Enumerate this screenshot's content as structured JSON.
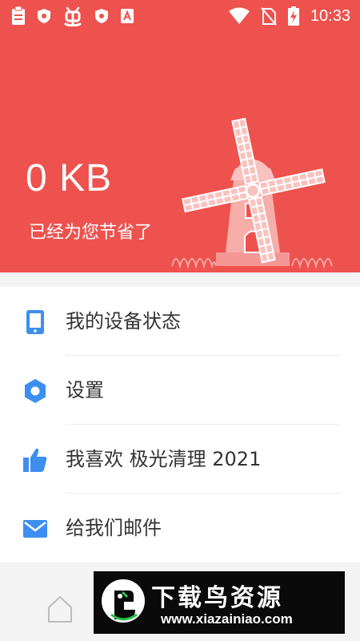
{
  "status_bar": {
    "time": "10:33",
    "left_icons": [
      "clipboard-icon",
      "shield-icon",
      "bug-icon",
      "shield-icon",
      "app-a-icon"
    ],
    "right_icons": [
      "wifi-icon",
      "no-sim-icon",
      "battery-charging-icon"
    ]
  },
  "header": {
    "background_color": "#ee524e",
    "saved_value": "0 KB",
    "saved_caption": "已经为您节省了",
    "illustration": "windmill-illustration"
  },
  "menu": {
    "items": [
      {
        "icon": "phone-icon",
        "label": "我的设备状态",
        "color": "#3d8ef0"
      },
      {
        "icon": "settings-icon",
        "label": "设置",
        "color": "#3d8ef0"
      },
      {
        "icon": "thumbs-up-icon",
        "label": "我喜欢 极光清理 2021",
        "color": "#3d8ef0"
      },
      {
        "icon": "mail-icon",
        "label": "给我们邮件",
        "color": "#3d8ef0"
      }
    ]
  },
  "navbar": {
    "home_icon": "home-icon"
  },
  "watermark": {
    "title": "下载鸟资源",
    "url": "www.xiazainiao.com"
  }
}
